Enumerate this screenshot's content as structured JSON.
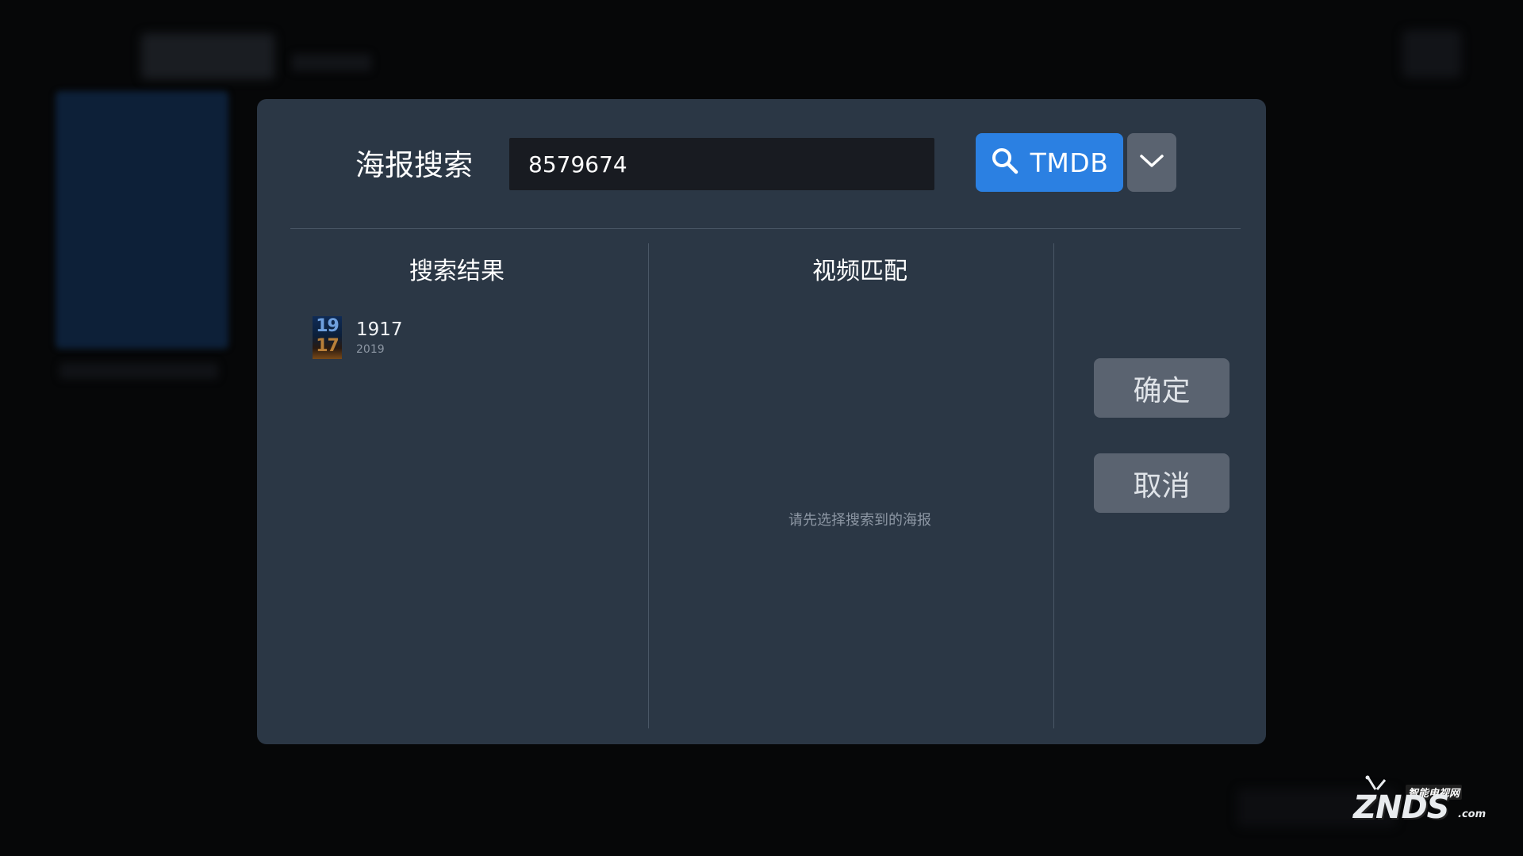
{
  "dialog": {
    "title": "海报搜索",
    "search": {
      "value": "8579674",
      "button_label": "TMDB",
      "icon": "search-icon",
      "dropdown_icon": "chevron-down-icon"
    },
    "columns": {
      "results_heading": "搜索结果",
      "match_heading": "视频匹配"
    },
    "results": [
      {
        "title": "1917",
        "year": "2019",
        "poster_text_top": "19",
        "poster_text_bottom": "17"
      }
    ],
    "match_placeholder": "请先选择搜索到的海报",
    "confirm_label": "确定",
    "cancel_label": "取消"
  },
  "watermark": {
    "brand": "ZNDS",
    "suffix": ".com",
    "cn_text": "智能电视网"
  },
  "colors": {
    "dialog_bg": "#2b3745",
    "accent": "#2b80e2",
    "button_gray": "#5a6370",
    "input_bg": "#181b21"
  }
}
